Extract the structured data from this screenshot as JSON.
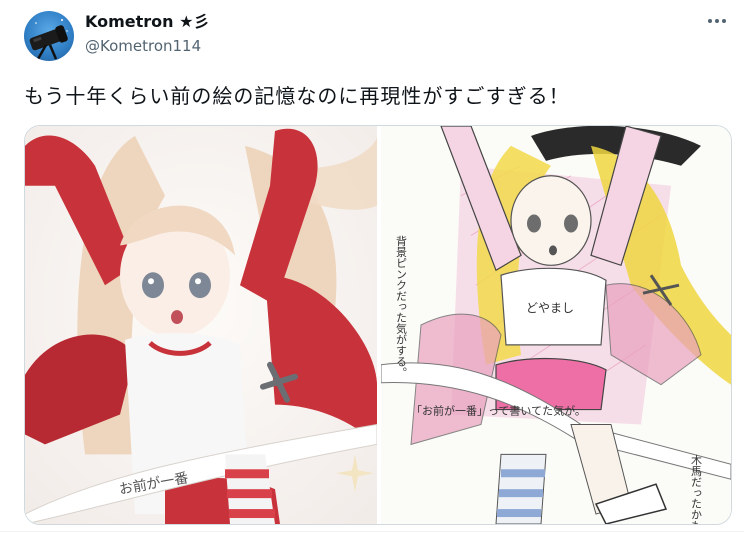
{
  "tweet": {
    "display_name": "Kometron ★彡",
    "handle": "@Kometron114",
    "text": "もう十年くらい前の絵の記憶なのに再現性がすごすぎる！"
  },
  "icons": {
    "more": "more-horizontal-icon",
    "avatar": "telescope-avatar"
  },
  "media": {
    "left_image": "digital-illustration-girl-in-gym-clothes",
    "right_image": "colored-pencil-sketch-girl-in-gym-clothes",
    "left_caption": "お前が一番",
    "right_shirt_text": "どやまし",
    "right_notes": [
      "背景ピンクだった気がする。",
      "「お前が一番」って書いてた気が。",
      "木馬だったかも"
    ]
  },
  "colors": {
    "text": "#0f1419",
    "secondary": "#536471",
    "border": "#cfd9de",
    "accent_red": "#c8323a"
  }
}
